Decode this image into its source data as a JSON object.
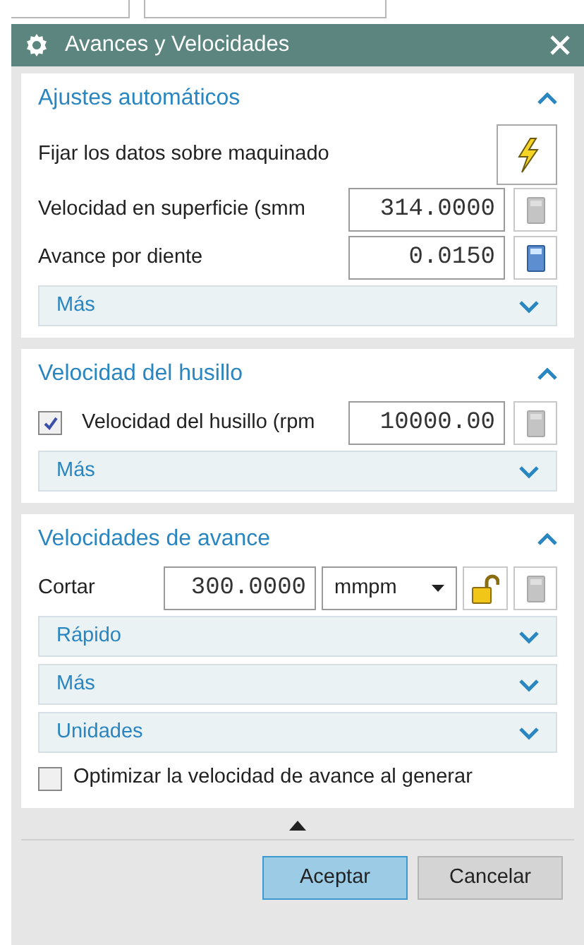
{
  "window": {
    "title": "Avances y Velocidades"
  },
  "sections": [
    {
      "title": "Ajustes automáticos",
      "expanded": true,
      "rows": [
        {
          "kind": "action",
          "label": "Fijar los datos sobre maquinado"
        },
        {
          "kind": "value",
          "label": "Velocidad en superficie (smm",
          "value": "314.0000",
          "calculator_enabled": false
        },
        {
          "kind": "value",
          "label": "Avance por diente",
          "value": "0.0150",
          "calculator_enabled": true
        },
        {
          "kind": "more",
          "label": "Más",
          "expanded": false
        }
      ]
    },
    {
      "title": "Velocidad del husillo",
      "expanded": true,
      "rows": [
        {
          "kind": "check_value",
          "label": "Velocidad del husillo (rpm",
          "checked": true,
          "value": "10000.00",
          "calculator_enabled": false
        },
        {
          "kind": "more",
          "label": "Más",
          "expanded": false
        }
      ]
    },
    {
      "title": "Velocidades de avance",
      "expanded": true,
      "rows": [
        {
          "kind": "feed",
          "label": "Cortar",
          "value": "300.0000",
          "unit": "mmpm",
          "locked": false,
          "calculator_enabled": false
        },
        {
          "kind": "more",
          "label": "Rápido",
          "expanded": false
        },
        {
          "kind": "more",
          "label": "Más",
          "expanded": false
        },
        {
          "kind": "more",
          "label": "Unidades",
          "expanded": false
        },
        {
          "kind": "check",
          "label": "Optimizar la velocidad de avance al generar",
          "checked": false
        }
      ]
    }
  ],
  "buttons": [
    {
      "label": "Aceptar",
      "selected": true
    },
    {
      "label": "Cancelar",
      "selected": false
    }
  ]
}
